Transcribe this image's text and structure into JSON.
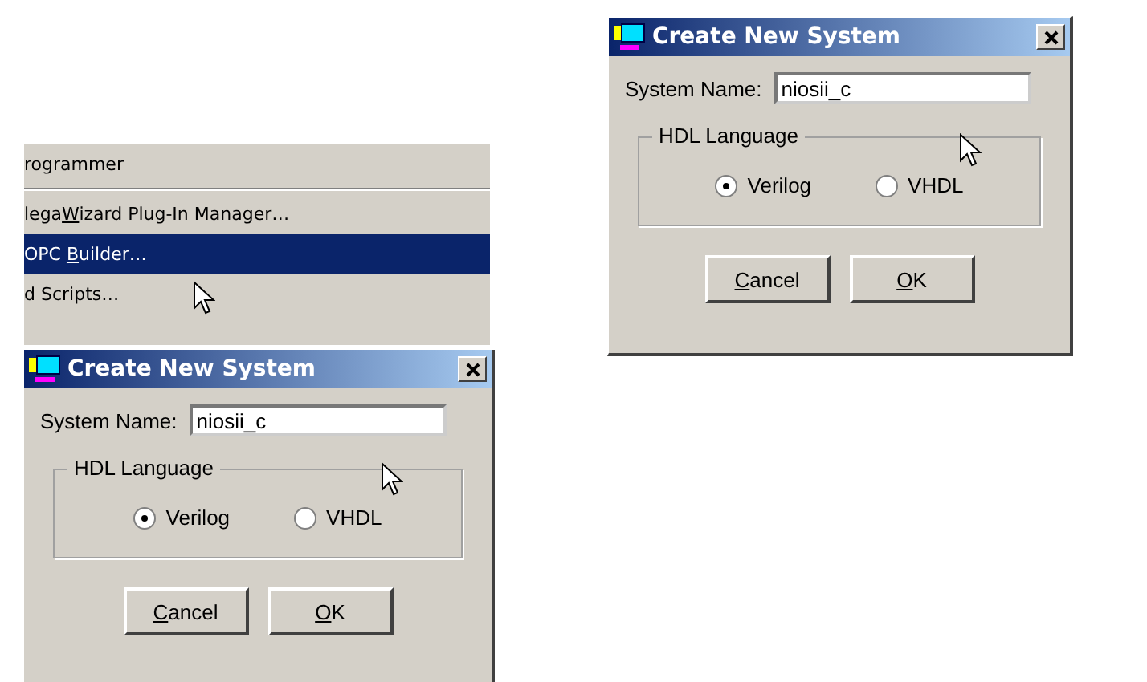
{
  "menu": {
    "items": [
      {
        "before": "rogrammer",
        "selected": false,
        "separator_after": true
      },
      {
        "before": "lega",
        "key": "W",
        "after": "izard Plug-In Manager…",
        "selected": false,
        "separator_after": false
      },
      {
        "before": "OPC ",
        "key": "B",
        "after": "uilder…",
        "selected": true,
        "separator_after": false
      },
      {
        "before": "d Scripts…",
        "selected": false,
        "separator_after": false
      }
    ]
  },
  "dialogs": [
    {
      "title": "Create New System",
      "name_label": "System Name:",
      "name_value": "niosii_c",
      "group_label": "HDL Language",
      "options": [
        {
          "label": "Verilog",
          "selected": true
        },
        {
          "label": "VHDL",
          "selected": false
        }
      ],
      "buttons": [
        {
          "key": "C",
          "after": "ancel"
        },
        {
          "key": "O",
          "after": "K"
        }
      ]
    },
    {
      "title": "Create New System",
      "name_label": "System Name:",
      "name_value": "niosii_c",
      "group_label": "HDL Language",
      "options": [
        {
          "label": "Verilog",
          "selected": true
        },
        {
          "label": "VHDL",
          "selected": false
        }
      ],
      "buttons": [
        {
          "key": "C",
          "after": "ancel"
        },
        {
          "key": "O",
          "after": "K"
        }
      ]
    }
  ]
}
